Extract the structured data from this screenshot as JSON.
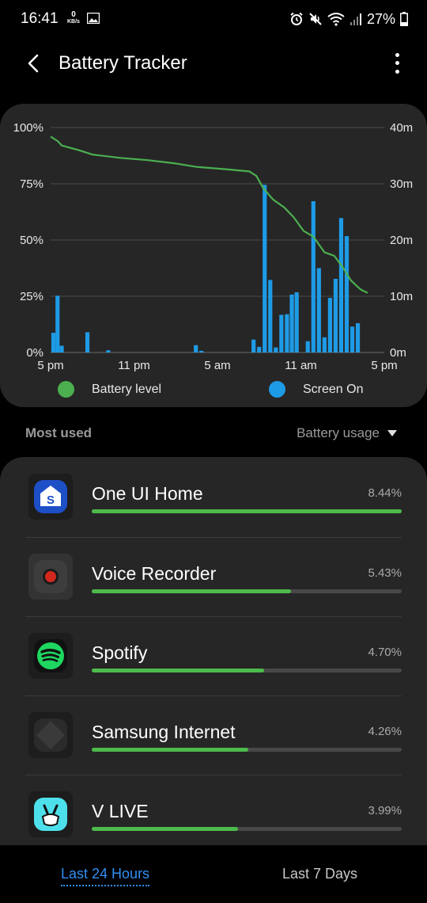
{
  "status_bar": {
    "time": "16:41",
    "net_speed_value": "0",
    "net_speed_unit": "KB/s",
    "battery_percent": "27%",
    "icons": [
      "gallery-icon",
      "alarm-icon",
      "mute-icon",
      "wifi-icon",
      "signal-icon",
      "battery-icon"
    ]
  },
  "app_bar": {
    "title": "Battery Tracker"
  },
  "chart": {
    "legend": {
      "battery": "Battery level",
      "screen": "Screen On"
    }
  },
  "chart_data": {
    "type": "bar+line",
    "title": "",
    "x_ticks": [
      "5 pm",
      "11 pm",
      "5 am",
      "11 am",
      "5 pm"
    ],
    "y_left_ticks": [
      "0%",
      "25%",
      "50%",
      "75%",
      "100%"
    ],
    "y_right_ticks": [
      "0m",
      "10m",
      "20m",
      "30m",
      "40m"
    ],
    "y_left_range": [
      0,
      100
    ],
    "y_right_range": [
      0,
      40
    ],
    "x_range_hours": [
      0,
      24
    ],
    "grid": true,
    "colors": {
      "battery": "#4caf50",
      "screen": "#1e9be6"
    },
    "screen_on_minutes": [
      {
        "hour": 0.05,
        "minutes": 3.5
      },
      {
        "hour": 0.35,
        "minutes": 10.1
      },
      {
        "hour": 0.65,
        "minutes": 1.2
      },
      {
        "hour": 2.5,
        "minutes": 3.6
      },
      {
        "hour": 4.0,
        "minutes": 0.4
      },
      {
        "hour": 10.3,
        "minutes": 1.3
      },
      {
        "hour": 10.7,
        "minutes": 0.3
      },
      {
        "hour": 14.45,
        "minutes": 2.3
      },
      {
        "hour": 14.85,
        "minutes": 1.0
      },
      {
        "hour": 15.25,
        "minutes": 29.8
      },
      {
        "hour": 15.65,
        "minutes": 12.9
      },
      {
        "hour": 16.05,
        "minutes": 0.9
      },
      {
        "hour": 16.45,
        "minutes": 6.7
      },
      {
        "hour": 16.85,
        "minutes": 6.8
      },
      {
        "hour": 17.2,
        "minutes": 10.3
      },
      {
        "hour": 17.55,
        "minutes": 10.7
      },
      {
        "hour": 18.35,
        "minutes": 2.0
      },
      {
        "hour": 18.75,
        "minutes": 26.9
      },
      {
        "hour": 19.15,
        "minutes": 15.0
      },
      {
        "hour": 19.55,
        "minutes": 2.7
      },
      {
        "hour": 19.95,
        "minutes": 9.7
      },
      {
        "hour": 20.35,
        "minutes": 13.1
      },
      {
        "hour": 20.75,
        "minutes": 23.9
      },
      {
        "hour": 21.15,
        "minutes": 20.7
      },
      {
        "hour": 21.55,
        "minutes": 4.6
      },
      {
        "hour": 21.95,
        "minutes": 5.2
      }
    ],
    "battery_level_percent": [
      {
        "hour": 0.0,
        "value": 96
      },
      {
        "hour": 0.5,
        "value": 94
      },
      {
        "hour": 0.8,
        "value": 92
      },
      {
        "hour": 2.0,
        "value": 90
      },
      {
        "hour": 3.0,
        "value": 88
      },
      {
        "hour": 5.0,
        "value": 86.5
      },
      {
        "hour": 7.0,
        "value": 85.5
      },
      {
        "hour": 9.0,
        "value": 84
      },
      {
        "hour": 10.5,
        "value": 82.5
      },
      {
        "hour": 12.5,
        "value": 81.5
      },
      {
        "hour": 14.3,
        "value": 80.5
      },
      {
        "hour": 14.8,
        "value": 78.5
      },
      {
        "hour": 15.3,
        "value": 73
      },
      {
        "hour": 16.0,
        "value": 68
      },
      {
        "hour": 16.8,
        "value": 64.5
      },
      {
        "hour": 17.5,
        "value": 60
      },
      {
        "hour": 18.2,
        "value": 54
      },
      {
        "hour": 18.9,
        "value": 51.5
      },
      {
        "hour": 19.3,
        "value": 48
      },
      {
        "hour": 19.7,
        "value": 44.5
      },
      {
        "hour": 20.4,
        "value": 43
      },
      {
        "hour": 21.0,
        "value": 38
      },
      {
        "hour": 21.6,
        "value": 32
      },
      {
        "hour": 22.3,
        "value": 28
      },
      {
        "hour": 22.8,
        "value": 26.5
      }
    ]
  },
  "most_used": {
    "title": "Most used",
    "sort_label": "Battery usage",
    "apps": [
      {
        "name": "One UI Home",
        "percent_label": "8.44%",
        "usage_fraction": 1.0,
        "icon": "one-ui-home-icon"
      },
      {
        "name": "Voice Recorder",
        "percent_label": "5.43%",
        "usage_fraction": 0.643,
        "icon": "voice-recorder-icon"
      },
      {
        "name": "Spotify",
        "percent_label": "4.70%",
        "usage_fraction": 0.557,
        "icon": "spotify-icon"
      },
      {
        "name": "Samsung Internet",
        "percent_label": "4.26%",
        "usage_fraction": 0.505,
        "icon": "samsung-internet-icon"
      },
      {
        "name": "V LIVE",
        "percent_label": "3.99%",
        "usage_fraction": 0.473,
        "icon": "vlive-icon"
      }
    ]
  },
  "tabs": {
    "active": "Last 24 Hours",
    "inactive": "Last 7 Days"
  }
}
